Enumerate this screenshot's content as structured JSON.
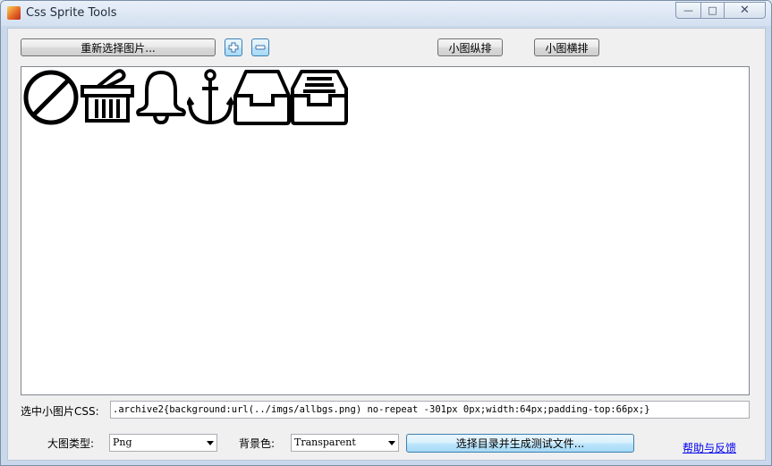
{
  "window": {
    "title": "Css Sprite Tools",
    "min_glyph": "—",
    "max_glyph": "□",
    "close_glyph": "✕"
  },
  "toolbar": {
    "reselect_label": "重新选择图片...",
    "add_glyph": "+",
    "remove_glyph": "−",
    "vertical_label": "小图纵排",
    "horizontal_label": "小图横排"
  },
  "sprites": [
    "ban-icon",
    "basket-icon",
    "bell-icon",
    "anchor-icon",
    "archive-icon",
    "archive2-icon"
  ],
  "css": {
    "label": "选中小图片CSS:",
    "value": ".archive2{background:url(../imgs/allbgs.png) no-repeat -301px 0px;width:64px;padding-top:66px;}"
  },
  "bottom": {
    "image_type_label": "大图类型:",
    "image_type_value": "Png",
    "bg_color_label": "背景色:",
    "bg_color_value": "Transparent",
    "generate_label": "选择目录并生成测试文件...",
    "help_link": "帮助与反馈"
  }
}
